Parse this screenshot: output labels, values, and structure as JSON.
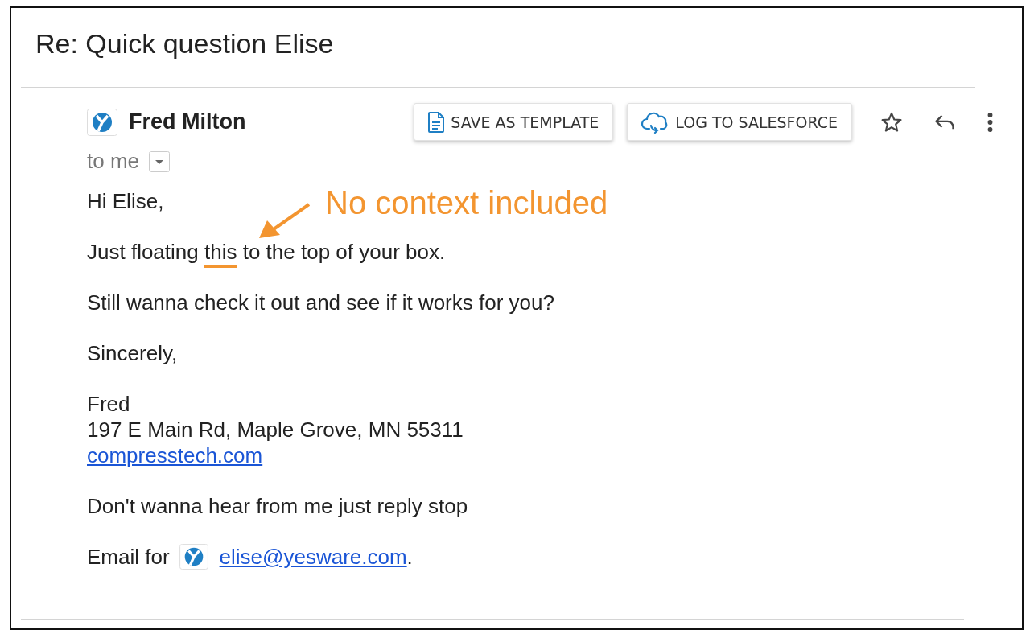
{
  "subject": "Re: Quick question Elise",
  "sender": {
    "name": "Fred Milton",
    "recipient": "to me"
  },
  "actions": [
    {
      "label": "SAVE AS TEMPLATE",
      "kind": "template"
    },
    {
      "label": "LOG TO SALESFORCE",
      "kind": "salesforce"
    }
  ],
  "toolbar": [
    {
      "kind": "star"
    },
    {
      "kind": "reply"
    },
    {
      "kind": "more"
    }
  ],
  "annotation": "No context included",
  "body": [
    {
      "kind": "text",
      "text": "Hi Elise,"
    },
    {
      "kind": "highlight",
      "before": "Just floating ",
      "highlight": "this",
      "after": " to the top of your box."
    },
    {
      "kind": "text",
      "text": "Still wanna check it out and see if it works for you?"
    },
    {
      "kind": "text",
      "text": "Sincerely,"
    },
    {
      "kind": "signature",
      "lines": [
        "Fred",
        "197 E Main Rd, Maple Grove, MN 55311"
      ],
      "link": "compresstech.com"
    },
    {
      "kind": "text",
      "text": "Don't wanna hear from me just reply stop"
    },
    {
      "kind": "email",
      "prefix": "Email for",
      "address": "elise@yesware.com",
      "suffix": "."
    }
  ]
}
